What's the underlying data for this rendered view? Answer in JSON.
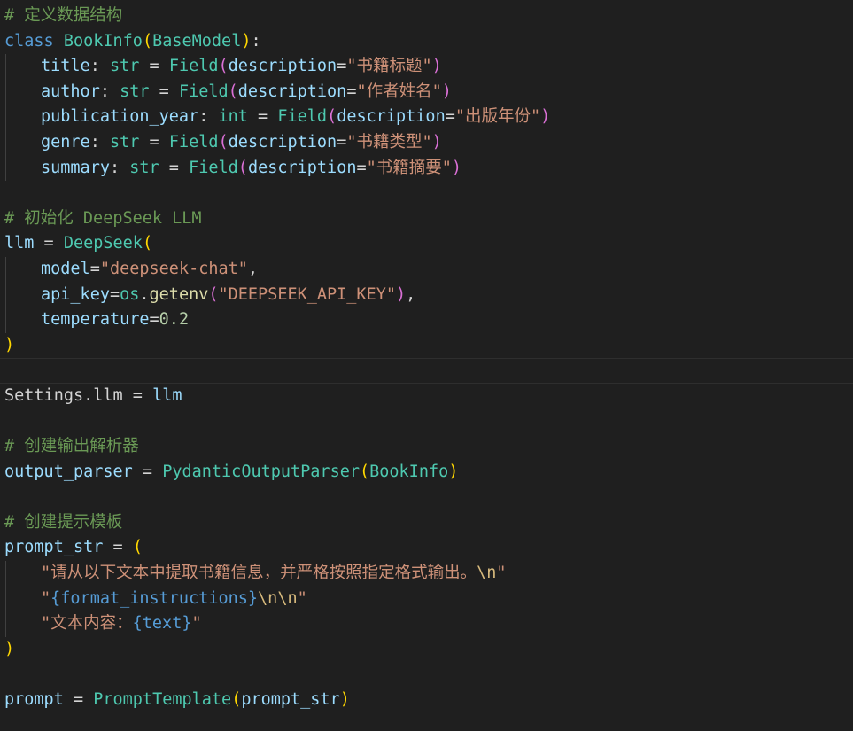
{
  "theme": {
    "background": "#1f1f1f",
    "comment": "#6a9955",
    "keyword": "#569cd6",
    "class_name": "#4ec9b0",
    "variable": "#9cdcfe",
    "function": "#dcdcaa",
    "string": "#ce9178",
    "number": "#b5cea8",
    "bracket_level1": "#ffd700",
    "bracket_level2": "#da70d6"
  },
  "code": {
    "comment_define": "# 定义数据结构",
    "kw_class": "class",
    "class_name": "BookInfo",
    "base_class": "BaseModel",
    "fields": [
      {
        "name": "title",
        "type": "str",
        "desc": "\"书籍标题\""
      },
      {
        "name": "author",
        "type": "str",
        "desc": "\"作者姓名\""
      },
      {
        "name": "publication_year",
        "type": "int",
        "desc": "\"出版年份\""
      },
      {
        "name": "genre",
        "type": "str",
        "desc": "\"书籍类型\""
      },
      {
        "name": "summary",
        "type": "str",
        "desc": "\"书籍摘要\""
      }
    ],
    "field_fn": "Field",
    "desc_kw": "description",
    "comment_init": "# 初始化 DeepSeek LLM",
    "llm_var": "llm",
    "llm_class": "DeepSeek",
    "model_kw": "model",
    "model_val": "\"deepseek-chat\"",
    "api_key_kw": "api_key",
    "os_mod": "os",
    "getenv_fn": "getenv",
    "api_key_val": "\"DEEPSEEK_API_KEY\"",
    "temperature_kw": "temperature",
    "temperature_val": "0.2",
    "settings_obj": "Settings",
    "settings_attr": "llm",
    "comment_parser": "# 创建输出解析器",
    "parser_var": "output_parser",
    "parser_class": "PydanticOutputParser",
    "comment_prompt": "# 创建提示模板",
    "prompt_str_var": "prompt_str",
    "str_line1": "\"请从以下文本中提取书籍信息，并严格按照指定格式输出。",
    "esc_n": "\\n",
    "quote": "\"",
    "format_placeholder": "{format_instructions}",
    "str_line3_text": "\"文本内容：",
    "text_placeholder": "{text}",
    "prompt_var": "prompt",
    "prompt_class": "PromptTemplate"
  }
}
